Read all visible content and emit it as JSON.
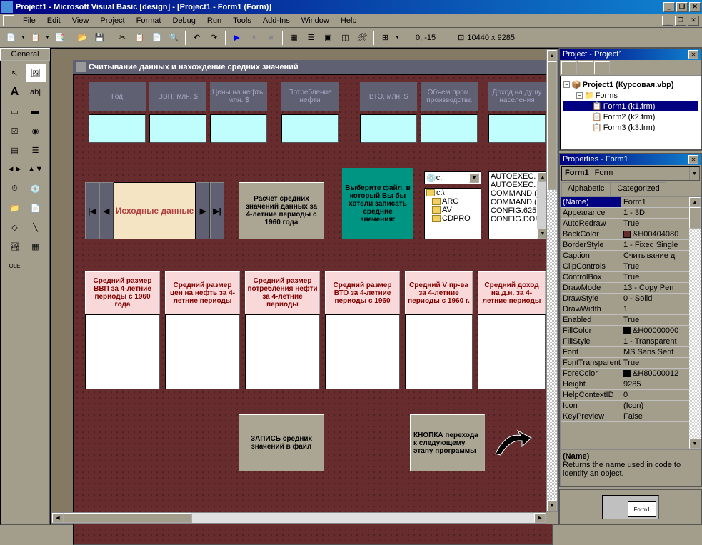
{
  "title": "Project1 - Microsoft Visual Basic [design] - [Project1 - Form1 (Form)]",
  "menu": [
    "File",
    "Edit",
    "View",
    "Project",
    "Format",
    "Debug",
    "Run",
    "Tools",
    "Add-Ins",
    "Window",
    "Help"
  ],
  "toolbar": {
    "coords": "0, -15",
    "size": "10440 x 9285"
  },
  "toolbox_tab": "General",
  "mdi_title": "Считывание данных и нахождение средних значений",
  "columns": [
    "Год",
    "ВВП, млн. $",
    "Цены на нефть, млн. $",
    "Потребление нефти",
    "ВТО, млн. $",
    "Объем пром. производства",
    "Доход на душу населения"
  ],
  "source_data_label": "Исходные данные",
  "calc_btn": "Расчет средних значений данных за 4-летние периоды с 1960 года",
  "teal_label": "Выберите файл, в который Вы бы хотели записать средние значения:",
  "drive": "c:",
  "dirs": [
    "c:\\",
    "ARC",
    "AV",
    "CDPRO"
  ],
  "files": [
    "AUTOEXEC.",
    "AUTOEXEC.",
    "COMMAND.(",
    "COMMAND.(",
    "CONFIG.625",
    "CONFIG.DO!"
  ],
  "avg_headers": [
    "Средний размер ВВП за 4-летние периоды с 1960 года",
    "Средний размер цен на нефть за 4-летние периоды",
    "Средний размер потребления нефти за 4-летние периоды",
    "Средний размер ВТО за 4-летние периоды с 1960",
    "Средний V пр-ва за 4-летние периоды с 1960 г.",
    "Средний доход на д.н. за 4-летние периоды"
  ],
  "write_btn": "ЗАПИСЬ средних значений в файл",
  "next_btn": "КНОПКА перехода к следующему этапу программы",
  "project_panel": {
    "title": "Project - Project1",
    "root": "Project1 (Курсовая.vbp)",
    "folder": "Forms",
    "items": [
      "Form1 (k1.frm)",
      "Form2 (k2.frm)",
      "Form3 (k3.frm)"
    ]
  },
  "props_panel": {
    "title": "Properties - Form1",
    "obj_name": "Form1",
    "obj_type": "Form",
    "tabs": [
      "Alphabetic",
      "Categorized"
    ],
    "props": [
      {
        "k": "(Name)",
        "v": "Form1",
        "sel": true
      },
      {
        "k": "Appearance",
        "v": "1 - 3D"
      },
      {
        "k": "AutoRedraw",
        "v": "True"
      },
      {
        "k": "BackColor",
        "v": "&H00404080",
        "sw": "#672d2e"
      },
      {
        "k": "BorderStyle",
        "v": "1 - Fixed Single"
      },
      {
        "k": "Caption",
        "v": "Считывание д"
      },
      {
        "k": "ClipControls",
        "v": "True"
      },
      {
        "k": "ControlBox",
        "v": "True"
      },
      {
        "k": "DrawMode",
        "v": "13 - Copy Pen"
      },
      {
        "k": "DrawStyle",
        "v": "0 - Solid"
      },
      {
        "k": "DrawWidth",
        "v": "1"
      },
      {
        "k": "Enabled",
        "v": "True"
      },
      {
        "k": "FillColor",
        "v": "&H00000000",
        "sw": "#000000"
      },
      {
        "k": "FillStyle",
        "v": "1 - Transparent"
      },
      {
        "k": "Font",
        "v": "MS Sans Serif"
      },
      {
        "k": "FontTransparent",
        "v": "True"
      },
      {
        "k": "ForeColor",
        "v": "&H80000012",
        "sw": "#000000"
      },
      {
        "k": "Height",
        "v": "9285"
      },
      {
        "k": "HelpContextID",
        "v": "0"
      },
      {
        "k": "Icon",
        "v": "(Icon)"
      },
      {
        "k": "KeyPreview",
        "v": "False"
      }
    ],
    "desc_title": "(Name)",
    "desc_text": "Returns the name used in code to identify an object."
  },
  "layout_mini": "Form1"
}
